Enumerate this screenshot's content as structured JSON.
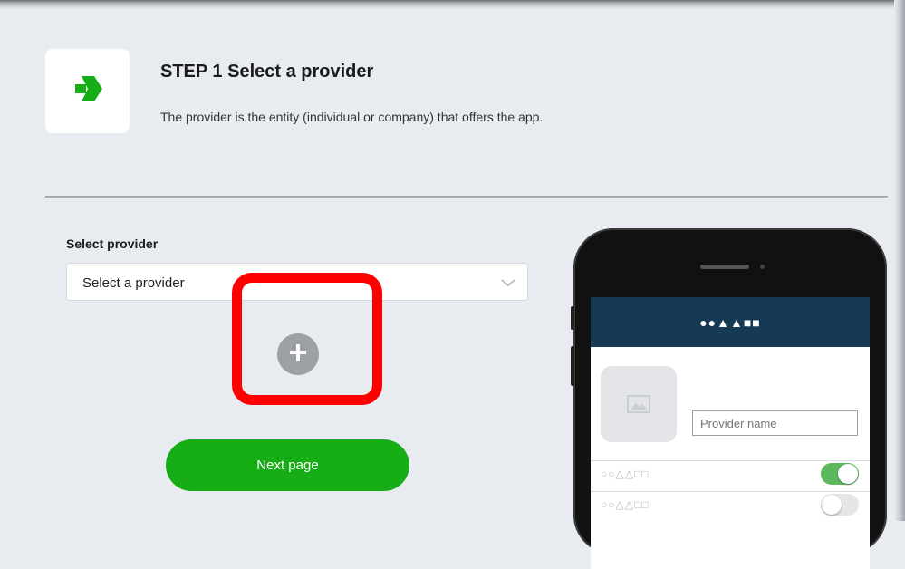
{
  "step": {
    "title": "STEP 1 Select a provider",
    "description": "The provider is the entity (individual or company) that offers the app.",
    "icon": "arrow-right-icon",
    "accent_color": "#17ad16"
  },
  "form": {
    "label": "Select provider",
    "select_value": "Select a provider",
    "add_icon": "plus-icon"
  },
  "next_button": {
    "label": "Next page"
  },
  "phone_preview": {
    "header_shapes": "●●▲▲■■",
    "header_color": "#163a53",
    "provider_name_placeholder": "Provider name",
    "rows": [
      {
        "shapes": "○○△△□□",
        "toggle_on": true
      },
      {
        "shapes": "○○△△□□",
        "toggle_on": false
      }
    ]
  },
  "highlight_color": "#ff0000"
}
